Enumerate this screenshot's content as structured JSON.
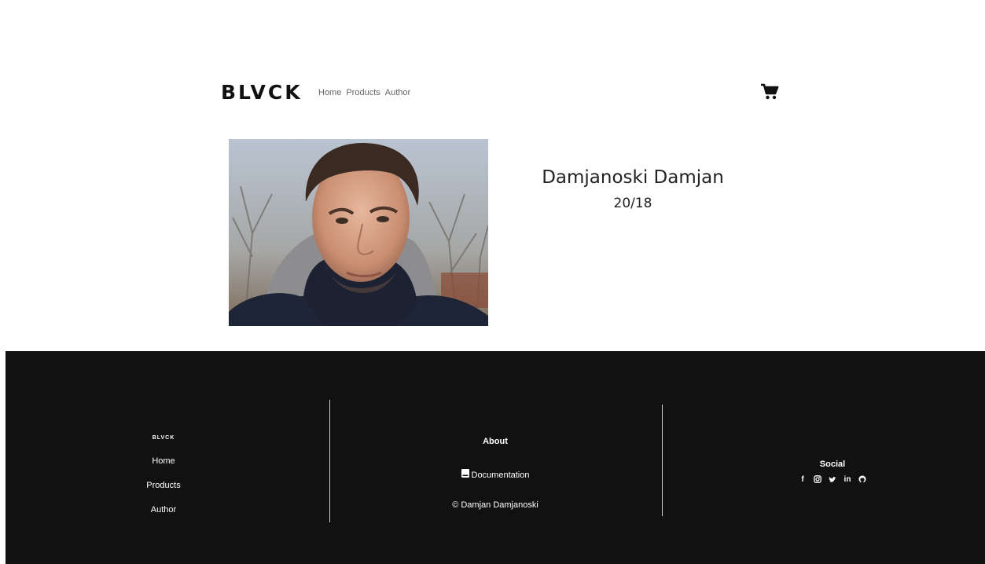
{
  "header": {
    "brand": "BLVCK",
    "nav": [
      {
        "label": "Home"
      },
      {
        "label": "Products"
      },
      {
        "label": "Author"
      }
    ],
    "cart_icon": "shopping-cart-icon"
  },
  "profile": {
    "name": "Damjanoski Damjan",
    "index": "20/18"
  },
  "footer": {
    "brand": "BLVCK",
    "links": [
      {
        "label": "Home"
      },
      {
        "label": "Products"
      },
      {
        "label": "Author"
      }
    ],
    "about": "About",
    "documentation": "Documentation",
    "copyright": "© Damjan Damjanoski",
    "social_title": "Social",
    "social": [
      {
        "icon": "facebook-icon",
        "glyph": "f"
      },
      {
        "icon": "instagram-icon",
        "glyph": ""
      },
      {
        "icon": "twitter-icon",
        "glyph": ""
      },
      {
        "icon": "linkedin-icon",
        "glyph": "in"
      },
      {
        "icon": "github-icon",
        "glyph": ""
      }
    ]
  },
  "colors": {
    "footer_bg": "#111111",
    "text_dark": "#222222",
    "nav_text": "#666666"
  }
}
